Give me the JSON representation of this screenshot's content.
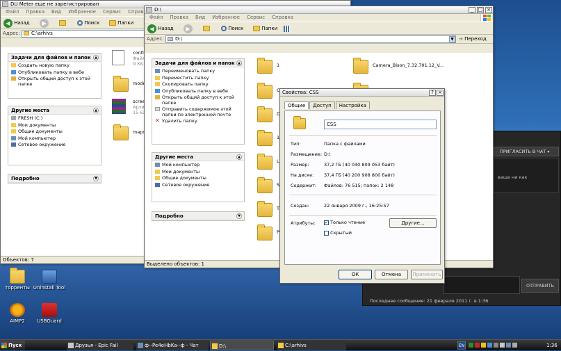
{
  "back_window": {
    "title": "DU Meter еще не зарегистрирован",
    "menu": [
      "Файл",
      "Правка",
      "Вид",
      "Избранное",
      "Сервис",
      "Справка"
    ],
    "toolbar": {
      "back": "Назад",
      "search": "Поиск",
      "folders": "Папки"
    },
    "address_label": "Адрес:",
    "address": "C:\\arhivs",
    "tasks_header": "Задачи для файлов и папок",
    "tasks": [
      "Создать новую папку",
      "Опубликовать папку в вебе",
      "Открыть общий доступ к этой папке"
    ],
    "places_header": "Другие места",
    "places": [
      "FRESH (C:)",
      "Мои документы",
      "Общие документы",
      "Мой компьютер",
      "Сетевое окружение"
    ],
    "details_header": "Подробно",
    "files": [
      {
        "name": "config",
        "sub1": "Файл",
        "sub2": "9 КБ"
      },
      {
        "name": "mode",
        "sub1": "",
        "sub2": ""
      },
      {
        "name": "scree",
        "sub1": "Архив",
        "sub2": "15 62"
      },
      {
        "name": "maps",
        "sub1": "",
        "sub2": ""
      }
    ],
    "status": "Объектов: 7"
  },
  "front_window": {
    "title": "D:\\",
    "menu": [
      "Файл",
      "Правка",
      "Вид",
      "Избранное",
      "Сервис",
      "Справка"
    ],
    "toolbar": {
      "back": "Назад",
      "search": "Поиск",
      "folders": "Папки"
    },
    "address_label": "Адрес:",
    "address": "D:\\",
    "go": "Переход",
    "tasks_header": "Задачи для файлов и папок",
    "tasks": [
      "Переименовать папку",
      "Переместить папку",
      "Скопировать папку",
      "Опубликовать папку в вебе",
      "Открыть общий доступ к этой папке",
      "Отправить содержимое этой папки по электронной почте",
      "Удалить папку"
    ],
    "places_header": "Другие места",
    "places": [
      "Мой компьютер",
      "Мои документы",
      "Общие документы",
      "Сетевое окружение"
    ],
    "details_header": "Подробно",
    "folders_col1": [
      "1",
      "CSS",
      "D",
      "1(",
      "L",
      "S",
      "T",
      "P"
    ],
    "folders_col2": [
      "Camera_Bison_7.32.701.12_V..."
    ],
    "status": "Выделено объектов: 1"
  },
  "dialog": {
    "title": "Свойства: CSS",
    "help": "?",
    "close": "×",
    "tabs": [
      "Общие",
      "Доступ",
      "Настройка"
    ],
    "name": "CSS",
    "rows": [
      {
        "label": "Тип:",
        "value": "Папка с файлами"
      },
      {
        "label": "Размещение:",
        "value": "D:\\"
      },
      {
        "label": "Размер:",
        "value": "37,2 ГБ (40 040 809 053 байт)"
      },
      {
        "label": "На диске:",
        "value": "37,4 ГБ (40 200 908 800 байт)"
      },
      {
        "label": "Содержит:",
        "value": "Файлов: 76 515; папок: 2 148"
      }
    ],
    "created_label": "Создан:",
    "created_value": "22 января 2009 г., 16:25:57",
    "attributes_label": "Атрибуты:",
    "readonly_label": "Только чтение",
    "hidden_label": "Скрытый",
    "other_button": "Другие...",
    "ok": "ОК",
    "cancel": "Отмена",
    "apply": "Применить"
  },
  "chat": {
    "invite_button": "ПРИГЛАСИТЬ В ЧАТ",
    "snippet": "ваще ни как",
    "send_button": "ОТПРАВИТЬ",
    "last_message": "Последнее сообщение: 21 февраля 2011 г. в 1:36"
  },
  "desktop": {
    "icons": [
      "торренты",
      "Uninstall Tool",
      "AIMP2",
      "USBGuard"
    ]
  },
  "taskbar": {
    "start": "Пуск",
    "tasks": [
      "Друзья - Epic Fail",
      "ф--Pe4eHbKa--ф - Чат",
      "D:\\",
      "C:\\arhivs"
    ],
    "lang": "EN",
    "clock": "1:36"
  }
}
